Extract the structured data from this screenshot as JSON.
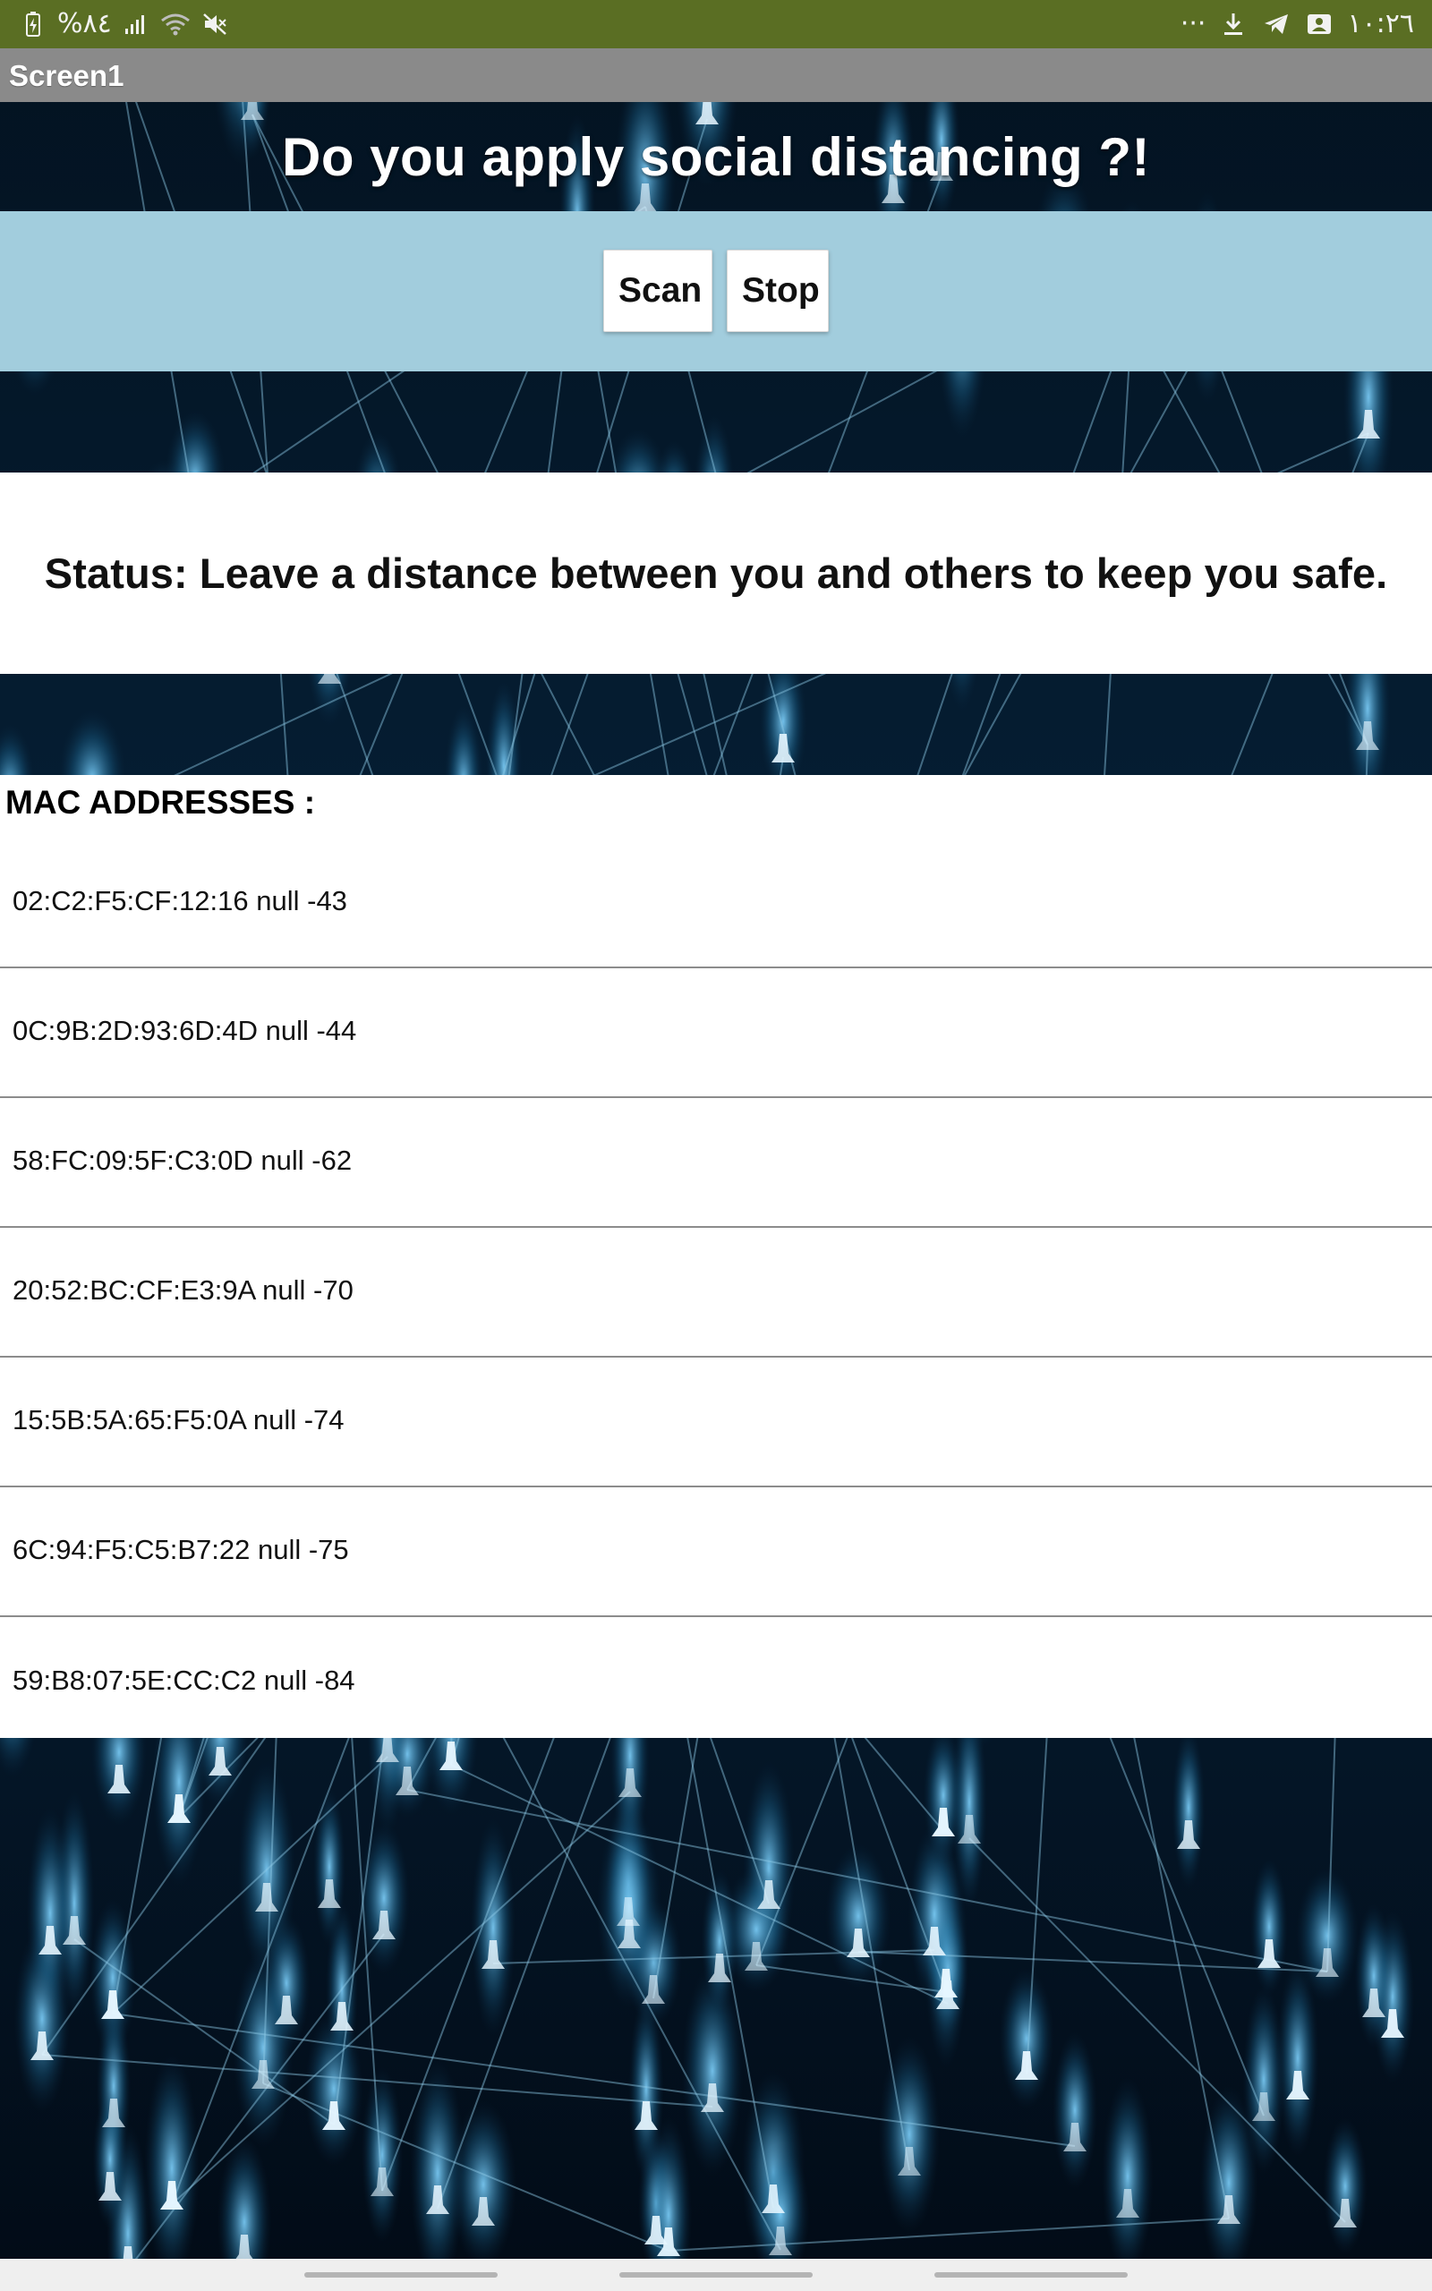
{
  "status_bar": {
    "battery_percent": "%٨٤",
    "time": "١٠:٢٦",
    "overflow": "···",
    "left_icons": [
      "battery-icon",
      "signal-icon",
      "wifi-icon",
      "mute-icon"
    ],
    "right_icons": [
      "download-icon",
      "telegram-icon",
      "gallery-icon"
    ]
  },
  "app": {
    "title": "Screen1"
  },
  "headline": "Do you apply social distancing ?!",
  "buttons": {
    "scan": "Scan",
    "stop": "Stop"
  },
  "status": "Status: Leave a distance between you and others to keep you safe.",
  "mac_section": {
    "title": "MAC ADDRESSES :",
    "items": [
      "02:C2:F5:CF:12:16 null -43",
      "0C:9B:2D:93:6D:4D null -44",
      "58:FC:09:5F:C3:0D null -62",
      "20:52:BC:CF:E3:9A null -70",
      "15:5B:5A:65:F5:0A null -74",
      "6C:94:F5:C5:B7:22 null -75",
      "59:B8:07:5E:CC:C2 null -84"
    ]
  },
  "colors": {
    "status_bar": "#5a6e23",
    "app_bar": "#8a8a8a",
    "button_band": "#a2cddd",
    "background_dark": "#041526",
    "background_glow": "#2f8fc2"
  }
}
